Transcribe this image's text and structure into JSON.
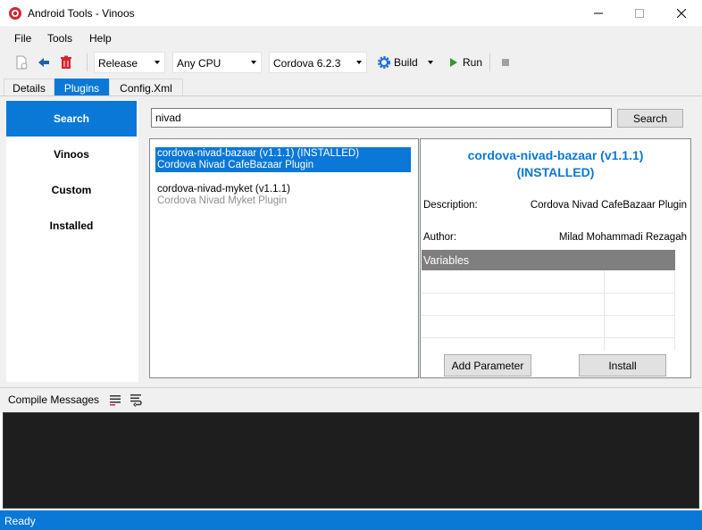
{
  "window": {
    "title": "Android Tools - Vinoos"
  },
  "menu": [
    "File",
    "Tools",
    "Help"
  ],
  "toolbar": {
    "configuration": "Release",
    "platform": "Any CPU",
    "cordova_version": "Cordova 6.2.3",
    "build_label": "Build",
    "run_label": "Run"
  },
  "tabs": [
    "Details",
    "Plugins",
    "Config.Xml"
  ],
  "sidebar": [
    "Search",
    "Vinoos",
    "Custom",
    "Installed"
  ],
  "search": {
    "value": "nivad",
    "button": "Search"
  },
  "plugins": [
    {
      "name": "cordova-nivad-bazaar (v1.1.1) (INSTALLED)",
      "description": "Cordova Nivad CafeBazaar Plugin"
    },
    {
      "name": "cordova-nivad-myket (v1.1.1)",
      "description": "Cordova Nivad Myket Plugin"
    }
  ],
  "detail": {
    "title_line1": "cordova-nivad-bazaar (v1.1.1)",
    "title_line2": "(INSTALLED)",
    "description_label": "Description:",
    "description_value": "Cordova Nivad CafeBazaar Plugin",
    "author_label": "Author:",
    "author_value": "Milad Mohammadi Rezagah",
    "variables_header": "Variables",
    "add_parameter": "Add Parameter",
    "install": "Install"
  },
  "compile": {
    "label": "Compile Messages"
  },
  "status": {
    "text": "Ready"
  },
  "colors": {
    "accent": "#0a78d7",
    "console_bg": "#1e1e1e",
    "danger": "#d9232e",
    "run": "#2e9b2e"
  }
}
